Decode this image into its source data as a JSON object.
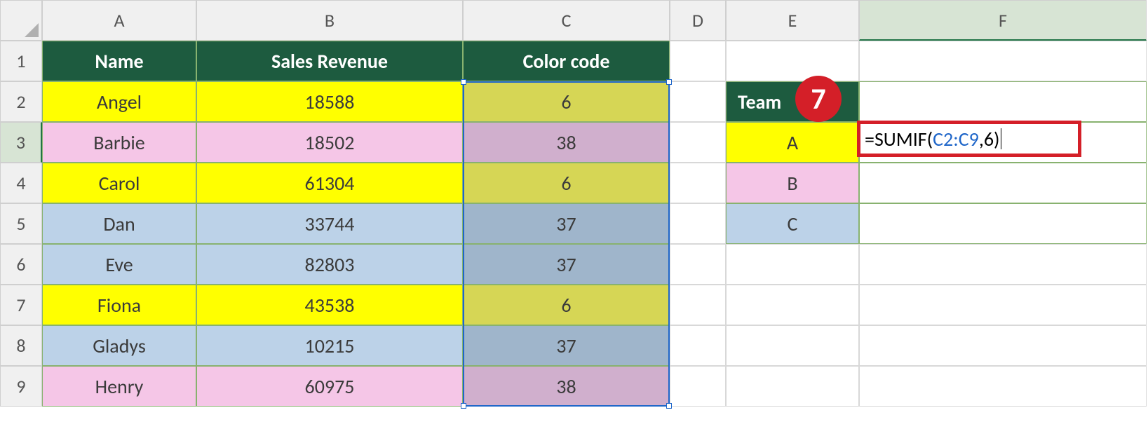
{
  "columns": [
    "A",
    "B",
    "C",
    "D",
    "E",
    "F"
  ],
  "rows": [
    "1",
    "2",
    "3",
    "4",
    "5",
    "6",
    "7",
    "8",
    "9"
  ],
  "headers": {
    "name": "Name",
    "revenue": "Sales Revenue",
    "colorcode": "Color code",
    "team": "Team"
  },
  "data": [
    {
      "name": "Angel",
      "revenue": "18588",
      "code": "6",
      "color": "yellow"
    },
    {
      "name": "Barbie",
      "revenue": "18502",
      "code": "38",
      "color": "pink"
    },
    {
      "name": "Carol",
      "revenue": "61304",
      "code": "6",
      "color": "yellow"
    },
    {
      "name": "Dan",
      "revenue": "33744",
      "code": "37",
      "color": "blue"
    },
    {
      "name": "Eve",
      "revenue": "82803",
      "code": "37",
      "color": "blue"
    },
    {
      "name": "Fiona",
      "revenue": "43538",
      "code": "6",
      "color": "yellow"
    },
    {
      "name": "Gladys",
      "revenue": "10215",
      "code": "37",
      "color": "blue"
    },
    {
      "name": "Henry",
      "revenue": "60975",
      "code": "38",
      "color": "pink"
    }
  ],
  "teams": [
    {
      "label": "A",
      "color": "yellow"
    },
    {
      "label": "B",
      "color": "pink"
    },
    {
      "label": "C",
      "color": "blue"
    }
  ],
  "formula": {
    "prefix": "=SUMIF(",
    "ref": "C2:C9",
    "suffix": ",6)",
    "full": "=SUMIF(C2:C9,6)"
  },
  "callout": "7",
  "selected_range": "C2:C9",
  "active_cell": "F3"
}
